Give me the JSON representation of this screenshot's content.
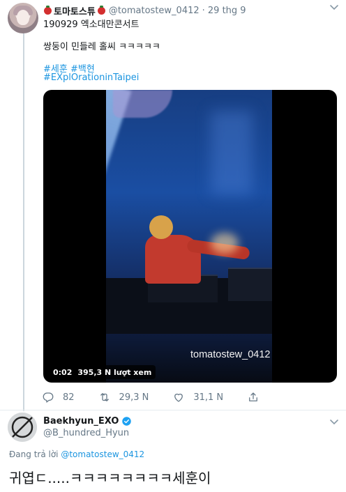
{
  "tweet1": {
    "display_name": "토마토스튜",
    "handle": "@tomatostew_0412",
    "date": "· 29 thg 9",
    "line1": "190929 엑소대만콘서트",
    "line2": "쌍둥이 민들레 홀씨 ㅋㅋㅋㅋㅋ",
    "hashtag_a": "#세훈",
    "hashtag_b": "#백현",
    "hashtag_c": "#EXplOrationinTaipei",
    "video": {
      "watermark": "tomatostew_0412",
      "duration": "0:02",
      "views": "395,3 N lượt xem"
    },
    "actions": {
      "reply_count": "82",
      "retweet_count": "29,3 N",
      "like_count": "31,1 N"
    }
  },
  "tweet2": {
    "display_name": "Baekhyun_EXO",
    "handle": "@B_hundred_Hyun",
    "replying_label": "Đang trả lời",
    "replying_to": "@tomatostew_0412",
    "text": "귀엽ㄷ.....ㅋㅋㅋㅋㅋㅋㅋㅋ세훈이"
  },
  "colors": {
    "link": "#1b95e0",
    "secondary_text": "#657786",
    "verified": "#1da1f2"
  },
  "icons": [
    "chevron-down-icon",
    "tomato-emoji-icon",
    "reply-icon",
    "retweet-icon",
    "like-icon",
    "share-icon",
    "verified-badge-icon"
  ]
}
